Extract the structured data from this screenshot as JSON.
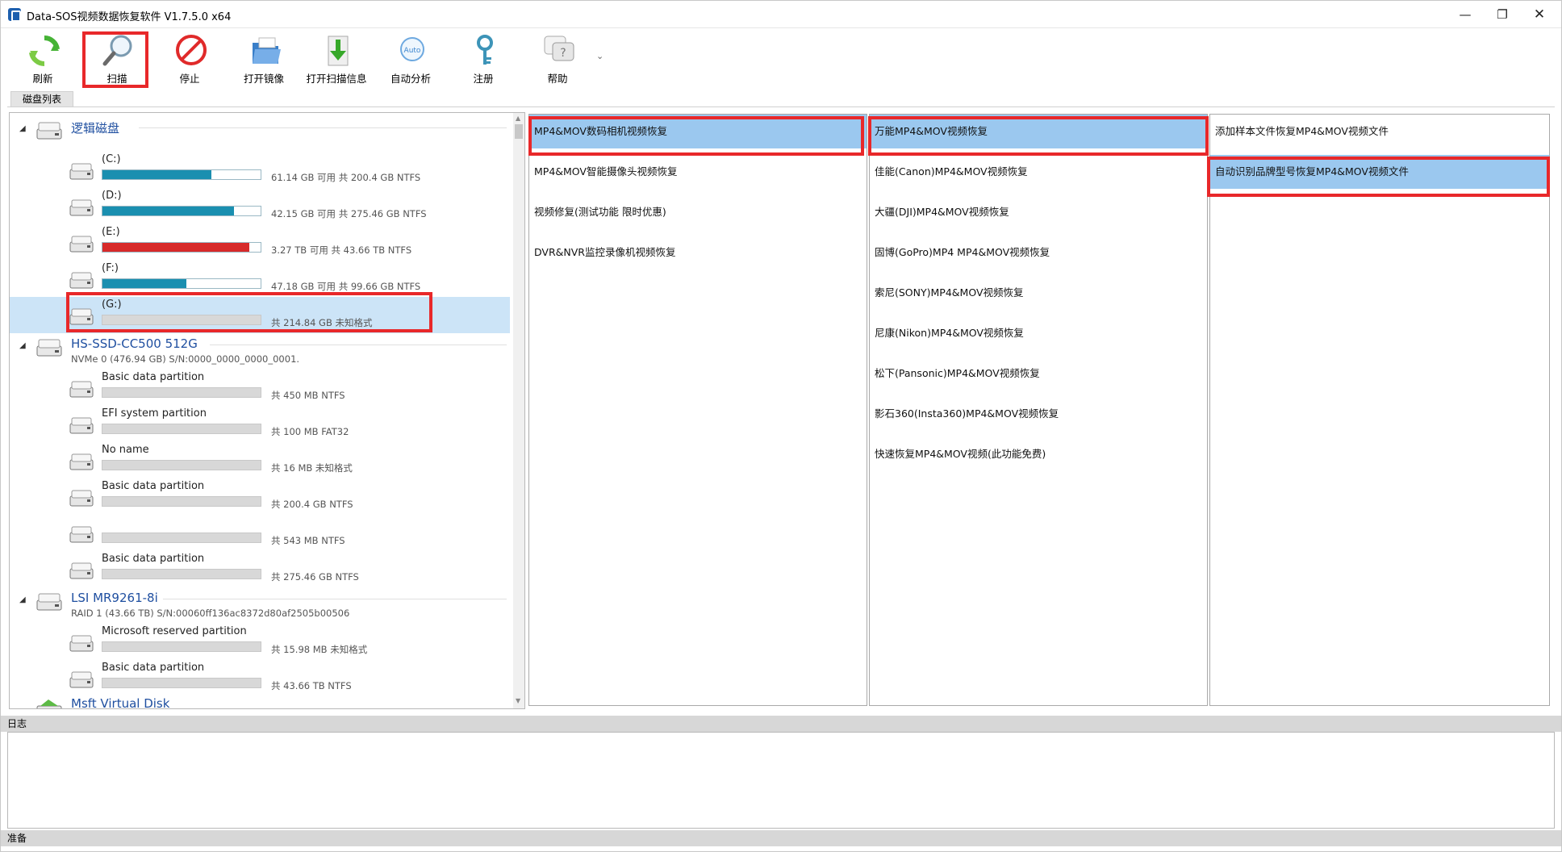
{
  "window": {
    "title": "Data-SOS视频数据恢复软件 V1.7.5.0 x64",
    "min": "—",
    "max": "❐",
    "close": "✕"
  },
  "toolbar": {
    "refresh": "刷新",
    "scan": "扫描",
    "stop": "停止",
    "open_image": "打开镜像",
    "open_scan_info": "打开扫描信息",
    "auto_analyze": "自动分析",
    "auto_text": "Auto",
    "register": "注册",
    "help": "帮助",
    "more": "⌄"
  },
  "tabs": {
    "disk_list": "磁盘列表"
  },
  "disk_tree": {
    "groups": [
      {
        "title": "逻辑磁盘",
        "subtitle": ""
      },
      {
        "title": "HS-SSD-CC500 512G",
        "subtitle": "NVMe 0 (476.94 GB) S/N:0000_0000_0000_0001."
      },
      {
        "title": "LSI MR9261-8i",
        "subtitle": "RAID 1 (43.66 TB) S/N:00060ff136ac8372d80af2505b00506"
      },
      {
        "title": "Msft Virtual Disk",
        "subtitle": ""
      }
    ],
    "logical": [
      {
        "name": "(C:)",
        "info": "61.14 GB 可用 共 200.4 GB NTFS",
        "used_fraction": 0.69,
        "color": "#1a8fb0"
      },
      {
        "name": "(D:)",
        "info": "42.15 GB 可用 共 275.46 GB NTFS",
        "used_fraction": 0.83,
        "color": "#1a8fb0"
      },
      {
        "name": "(E:)",
        "info": "3.27 TB 可用 共 43.66 TB NTFS",
        "used_fraction": 0.93,
        "color": "#d72a2a"
      },
      {
        "name": "(F:)",
        "info": "47.18 GB 可用 共 99.66 GB NTFS",
        "used_fraction": 0.53,
        "color": "#1a8fb0"
      },
      {
        "name": "(G:)",
        "info": "共 214.84 GB 未知格式",
        "used_fraction": 0,
        "color": "#d8d8d8"
      }
    ],
    "ssd": [
      {
        "name": "Basic data partition",
        "info": "共 450 MB NTFS"
      },
      {
        "name": "EFI system partition",
        "info": "共 100 MB FAT32"
      },
      {
        "name": "No name",
        "info": "共 16 MB 未知格式"
      },
      {
        "name": "Basic data partition",
        "info": "共 200.4 GB NTFS"
      },
      {
        "name": "",
        "info": "共 543 MB NTFS"
      },
      {
        "name": "Basic data partition",
        "info": "共 275.46 GB NTFS"
      }
    ],
    "raid": [
      {
        "name": "Microsoft reserved partition",
        "info": "共 15.98 MB 未知格式"
      },
      {
        "name": "Basic data partition",
        "info": "共 43.66 TB NTFS"
      }
    ]
  },
  "col_a": [
    "MP4&MOV数码相机视频恢复",
    "MP4&MOV智能摄像头视频恢复",
    "视频修复(测试功能 限时优惠)",
    "DVR&NVR监控录像机视频恢复"
  ],
  "col_b": [
    "万能MP4&MOV视频恢复",
    "佳能(Canon)MP4&MOV视频恢复",
    "大疆(DJI)MP4&MOV视频恢复",
    "固博(GoPro)MP4 MP4&MOV视频恢复",
    "索尼(SONY)MP4&MOV视频恢复",
    "尼康(Nikon)MP4&MOV视频恢复",
    "松下(Pansonic)MP4&MOV视频恢复",
    "影石360(Insta360)MP4&MOV视频恢复",
    "快速恢复MP4&MOV视频(此功能免费)"
  ],
  "col_c": [
    "添加样本文件恢复MP4&MOV视频文件",
    "自动识别品牌型号恢复MP4&MOV视频文件"
  ],
  "log": {
    "label": "日志"
  },
  "status": {
    "text": "准备"
  },
  "colors": {
    "highlight": "#e8282a",
    "selection": "#9bc8ef",
    "tree_title": "#1f4fa0"
  }
}
